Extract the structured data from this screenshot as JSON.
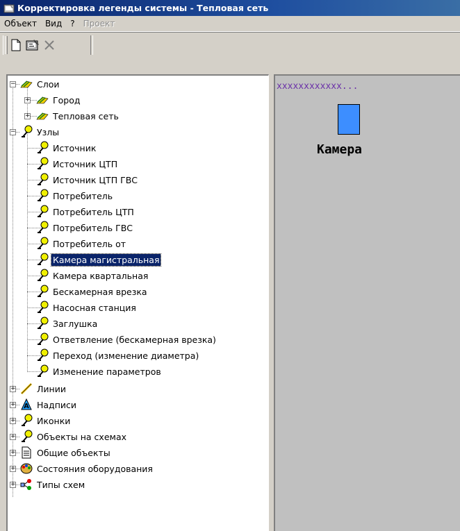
{
  "window": {
    "title": "Корректировка легенды системы - Тепловая сеть"
  },
  "menu": [
    {
      "label": "Объект",
      "enabled": true
    },
    {
      "label": "Вид",
      "enabled": true
    },
    {
      "label": "?",
      "enabled": true
    },
    {
      "label": "Проект",
      "enabled": false
    }
  ],
  "toolbar": {
    "buttons": [
      "new-icon",
      "properties-icon",
      "delete-icon"
    ]
  },
  "tree": {
    "layers": {
      "label": "Слои",
      "children": [
        "Город",
        "Тепловая сеть"
      ]
    },
    "nodes": {
      "label": "Узлы",
      "children": [
        "Источник",
        "Источник ЦТП",
        "Источник ЦТП ГВС",
        "Потребитель",
        "Потребитель ЦТП",
        "Потребитель ГВС",
        "Потребитель от",
        "Камера магистральная",
        "Камера квартальная",
        "Бескамерная врезка",
        "Насосная станция",
        "Заглушка",
        "Ответвление (бескамерная врезка)",
        "Переход (изменение диаметра)",
        "Изменение параметров"
      ],
      "selected": "Камера магистральная"
    },
    "others": [
      {
        "label": "Линии",
        "icon": "line-icon"
      },
      {
        "label": "Надписи",
        "icon": "text-label-icon"
      },
      {
        "label": "Иконки",
        "icon": "node-pin-icon"
      },
      {
        "label": "Объекты на схемах",
        "icon": "node-pin-icon"
      },
      {
        "label": "Общие объекты",
        "icon": "document-icon"
      },
      {
        "label": "Состояния оборудования",
        "icon": "palette-icon"
      },
      {
        "label": "Типы схем",
        "icon": "scheme-types-icon"
      }
    ]
  },
  "preview": {
    "header_text": "xxxxxxxxxxxx...",
    "symbol_color": "#3d8eff",
    "symbol_label": "Камера"
  }
}
